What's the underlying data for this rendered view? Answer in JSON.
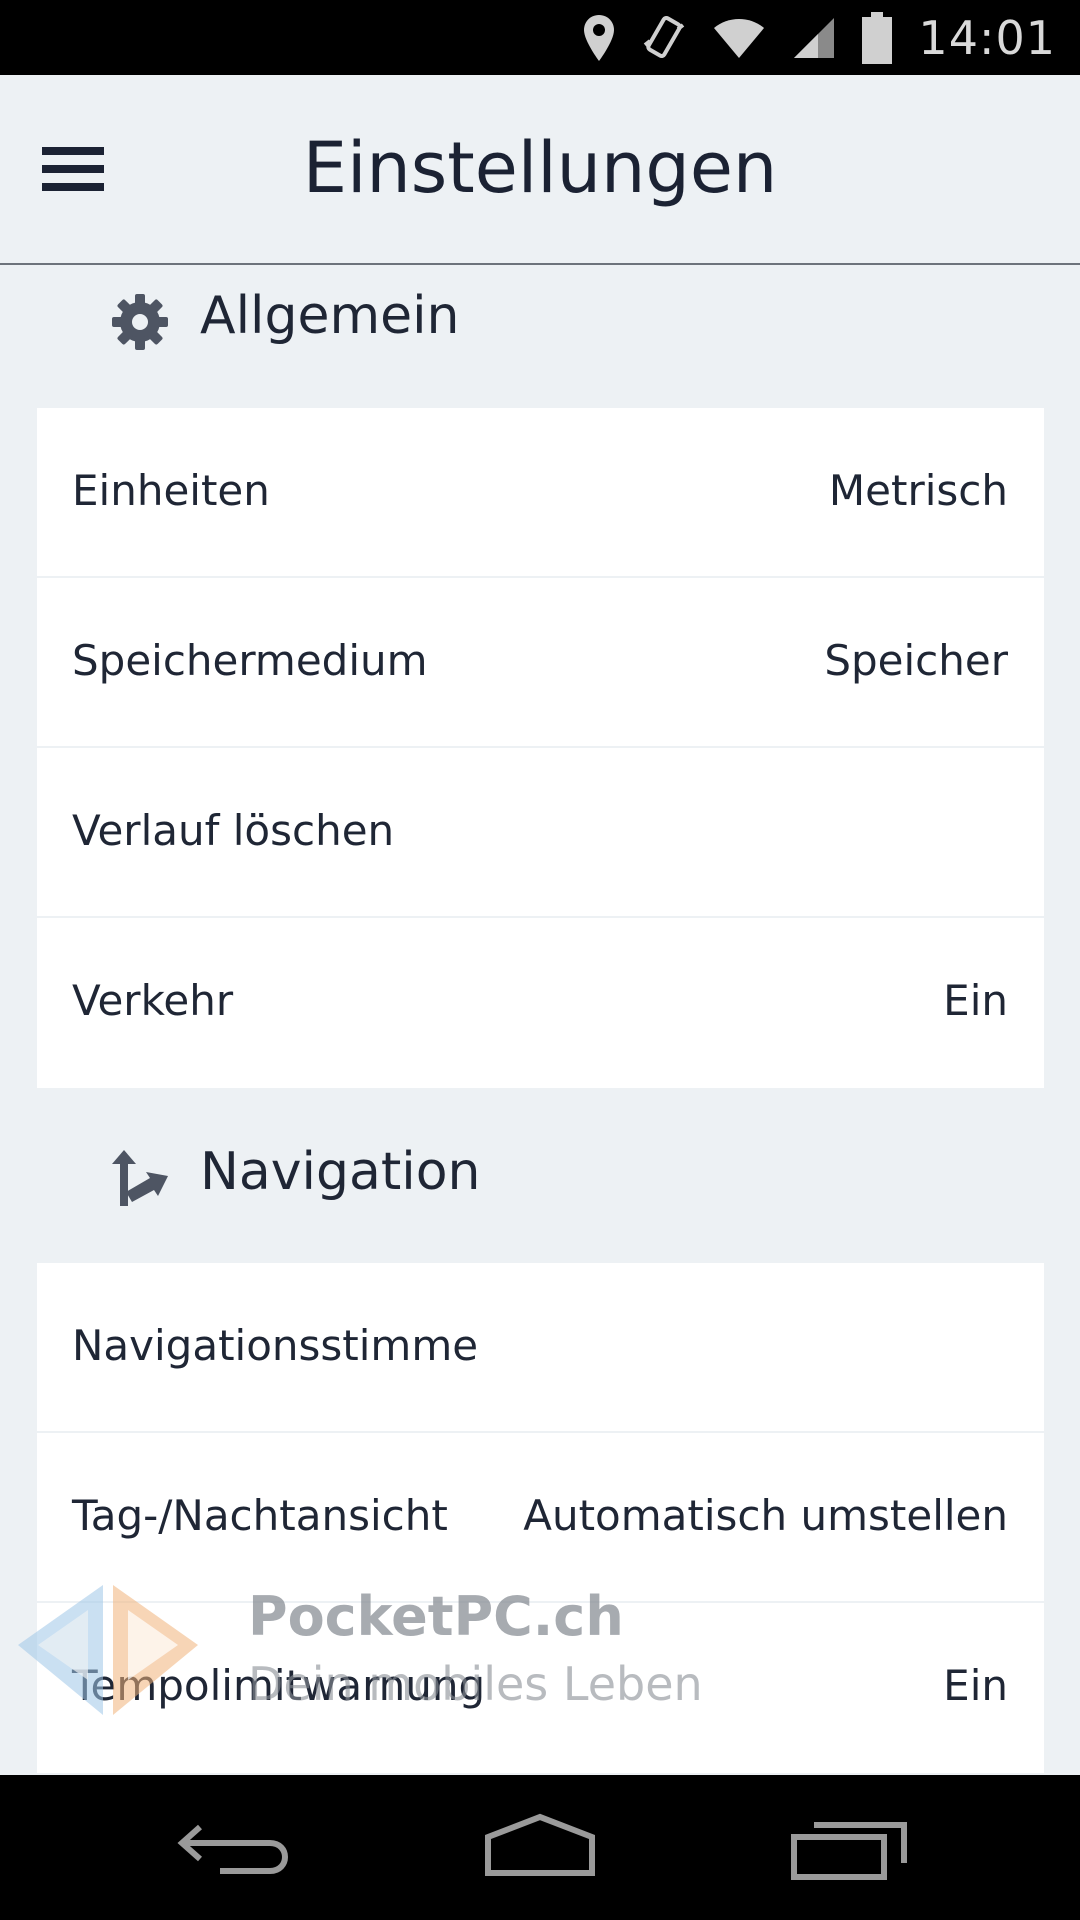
{
  "status_bar": {
    "time": "14:01",
    "icons": [
      "location-icon",
      "vibrate-icon",
      "wifi-icon",
      "signal-icon",
      "battery-icon"
    ]
  },
  "app_bar": {
    "title": "Einstellungen",
    "menu_icon": "hamburger-menu-icon"
  },
  "sections": [
    {
      "title": "Allgemein",
      "icon": "gear-icon",
      "rows": [
        {
          "label": "Einheiten",
          "value": "Metrisch"
        },
        {
          "label": "Speichermedium",
          "value": "Speicher"
        },
        {
          "label": "Verlauf löschen",
          "value": ""
        },
        {
          "label": "Verkehr",
          "value": "Ein"
        }
      ]
    },
    {
      "title": "Navigation",
      "icon": "route-arrow-icon",
      "rows": [
        {
          "label": "Navigationsstimme",
          "value": ""
        },
        {
          "label": "Tag-/Nachtansicht",
          "value": "Automatisch umstellen"
        },
        {
          "label": "Tempolimitwarnung",
          "value": "Ein"
        }
      ]
    }
  ],
  "watermark": {
    "brand": "PocketPC.ch",
    "slogan": "Dein mobiles Leben"
  },
  "nav_bar": {
    "icons": [
      "back-icon",
      "home-icon",
      "recents-icon"
    ]
  },
  "colors": {
    "background": "#edf1f4",
    "card": "#ffffff",
    "text": "#1f2635",
    "icon": "#4e5563"
  }
}
